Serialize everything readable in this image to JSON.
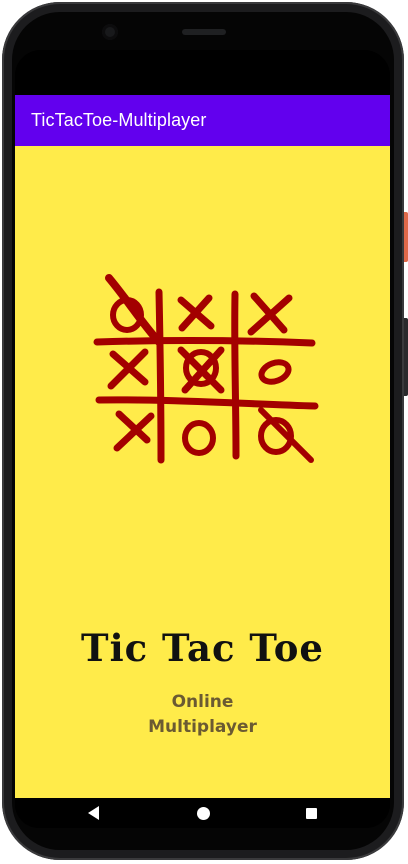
{
  "app": {
    "title": "TicTacToe-Multiplayer"
  },
  "main": {
    "logo_icon": "tic-tac-toe-board-icon",
    "game_title": "Tic Tac Toe",
    "subtitle_line1": "Online",
    "subtitle_line2": "Multiplayer"
  },
  "nav": {
    "back_icon": "back-triangle-icon",
    "home_icon": "home-circle-icon",
    "recents_icon": "recents-square-icon"
  },
  "colors": {
    "app_bar": "#6200ee",
    "background": "#ffeb4a",
    "logo": "#a30000",
    "title_text": "#111111",
    "subtitle_text": "#6b5a32"
  }
}
